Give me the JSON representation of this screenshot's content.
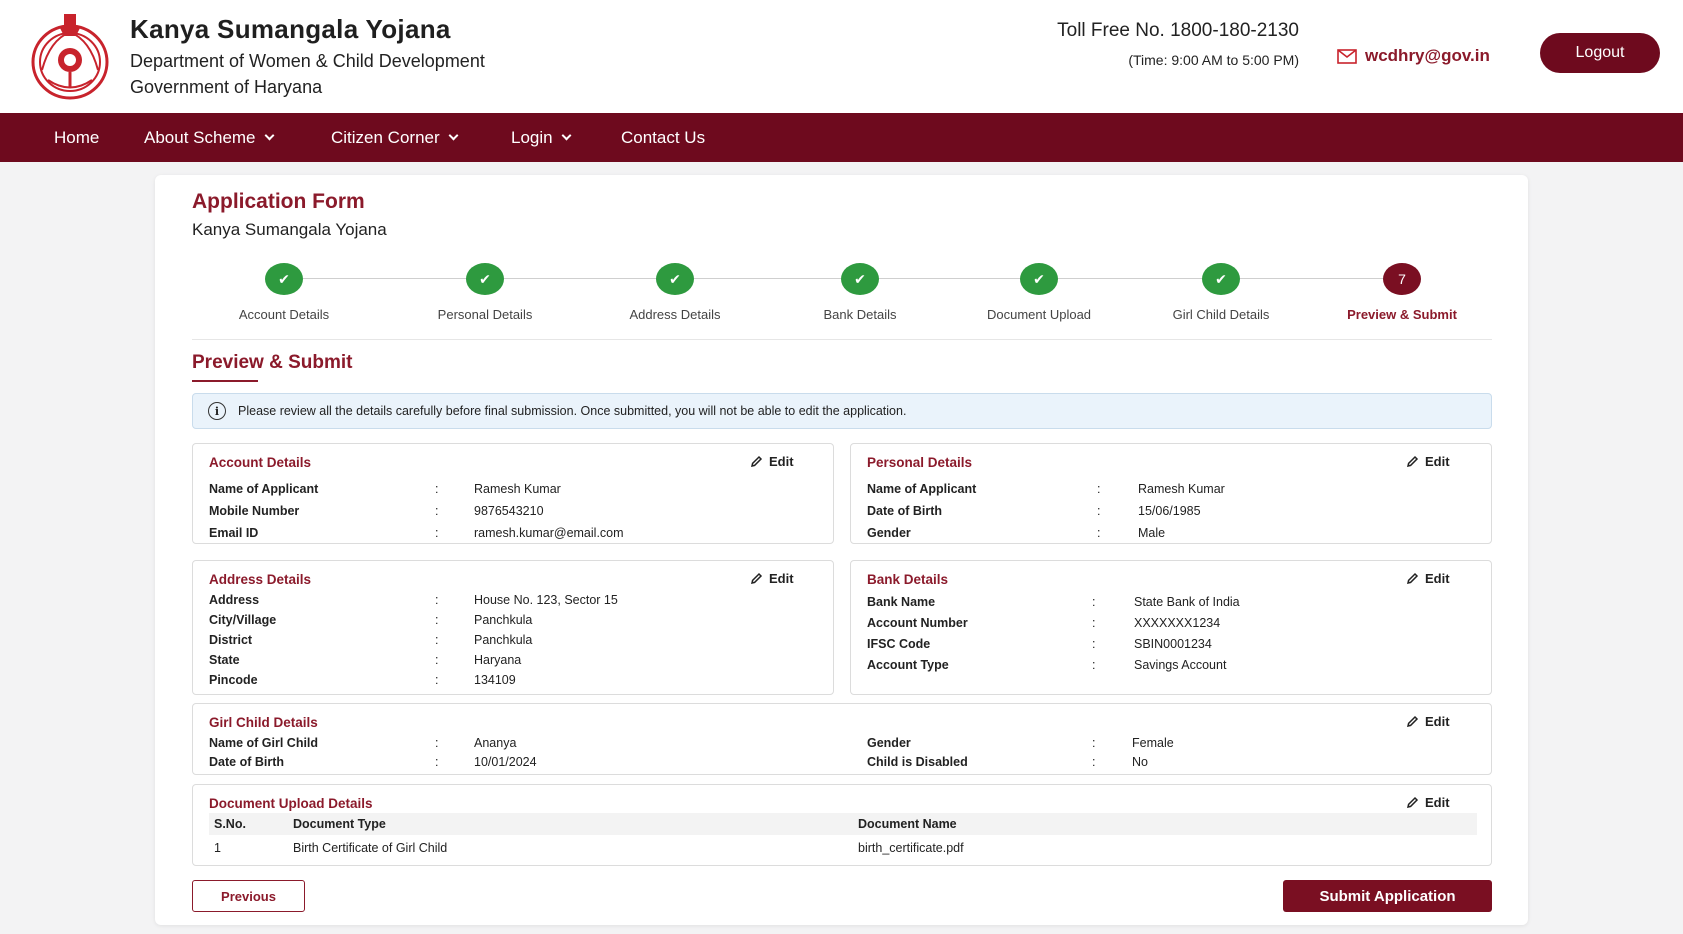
{
  "header": {
    "title": "Kanya Sumangala Yojana",
    "department": "Department of Women & Child Development",
    "government": "Government of Haryana",
    "toll_free": "Toll Free No. 1800-180-2130",
    "timing": "(Time: 9:00 AM to 5:00 PM)",
    "email": "wcdhry@gov.in",
    "logout_label": "Logout"
  },
  "nav": {
    "items": [
      {
        "label": "Home",
        "dropdown": false
      },
      {
        "label": "About Scheme",
        "dropdown": true
      },
      {
        "label": "Citizen Corner",
        "dropdown": true
      },
      {
        "label": "Login",
        "dropdown": true
      },
      {
        "label": "Contact Us",
        "dropdown": false
      }
    ]
  },
  "form": {
    "title": "Application Form",
    "subtitle": "Kanya Sumangala Yojana"
  },
  "steps": [
    {
      "label": "Account Details",
      "status": "done"
    },
    {
      "label": "Personal Details",
      "status": "done"
    },
    {
      "label": "Address Details",
      "status": "done"
    },
    {
      "label": "Bank Details",
      "status": "done"
    },
    {
      "label": "Document Upload",
      "status": "done"
    },
    {
      "label": "Girl Child Details",
      "status": "done"
    },
    {
      "label": "Preview & Submit",
      "status": "active",
      "number": "7"
    }
  ],
  "section": {
    "title": "Preview & Submit",
    "notice": "Please review all the details carefully before final submission. Once submitted, you will not be able to edit the application."
  },
  "edit_label": "Edit",
  "account": {
    "title": "Account Details",
    "rows": [
      {
        "label": "Name of Applicant",
        "value": "Ramesh Kumar"
      },
      {
        "label": "Mobile Number",
        "value": "9876543210"
      },
      {
        "label": "Email ID",
        "value": "ramesh.kumar@email.com"
      }
    ]
  },
  "personal": {
    "title": "Personal Details",
    "rows": [
      {
        "label": "Name of Applicant",
        "value": "Ramesh Kumar"
      },
      {
        "label": "Date of Birth",
        "value": "15/06/1985"
      },
      {
        "label": "Gender",
        "value": "Male"
      }
    ]
  },
  "address": {
    "title": "Address Details",
    "rows": [
      {
        "label": "Address",
        "value": "House No. 123, Sector 15"
      },
      {
        "label": "City/Village",
        "value": "Panchkula"
      },
      {
        "label": "District",
        "value": "Panchkula"
      },
      {
        "label": "State",
        "value": "Haryana"
      },
      {
        "label": "Pincode",
        "value": "134109"
      }
    ]
  },
  "bank": {
    "title": "Bank Details",
    "rows": [
      {
        "label": "Bank Name",
        "value": "State Bank of India"
      },
      {
        "label": "Account Number",
        "value": "XXXXXXX1234"
      },
      {
        "label": "IFSC Code",
        "value": "SBIN0001234"
      },
      {
        "label": "Account Type",
        "value": "Savings Account"
      }
    ]
  },
  "girl_child": {
    "title": "Girl Child Details",
    "left": [
      {
        "label": "Name of Girl Child",
        "value": "Ananya"
      },
      {
        "label": "Date of Birth",
        "value": "10/01/2024"
      }
    ],
    "right": [
      {
        "label": "Gender",
        "value": "Female"
      },
      {
        "label": "Child is Disabled",
        "value": "No"
      }
    ]
  },
  "documents": {
    "title": "Document Upload Details",
    "headers": [
      "S.No.",
      "Document Type",
      "Document Name"
    ],
    "rows": [
      [
        "1",
        "Birth Certificate of Girl Child",
        "birth_certificate.pdf"
      ]
    ]
  },
  "buttons": {
    "previous": "Previous",
    "submit": "Submit Application"
  },
  "colors": {
    "brand": "#6e0a1e",
    "accent": "#8b1a2b",
    "success": "#2e9a3f"
  }
}
